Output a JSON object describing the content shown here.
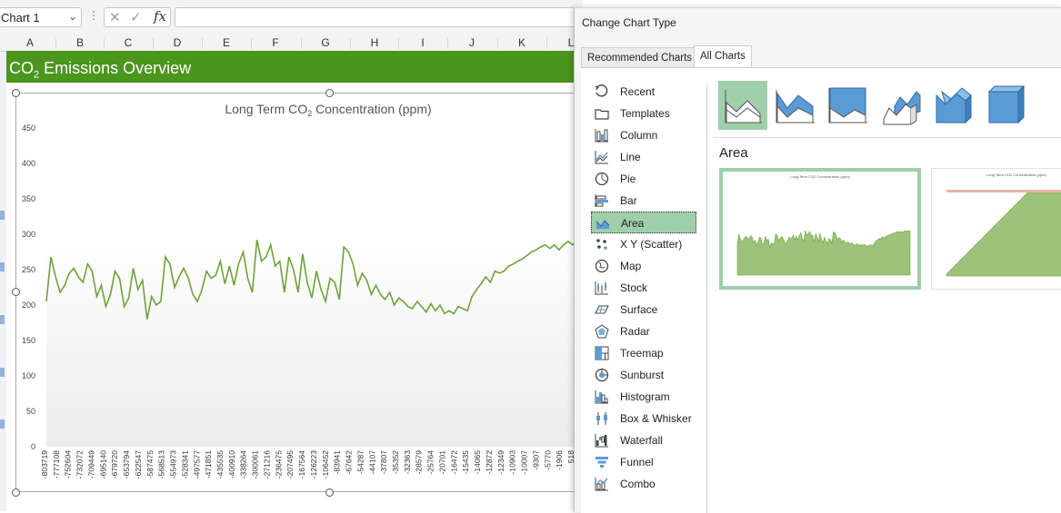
{
  "formula_bar": {
    "name_box": "Chart 1",
    "fx_label": "fx"
  },
  "columns": [
    "A",
    "B",
    "C",
    "D",
    "E",
    "F",
    "G",
    "H",
    "I",
    "J",
    "K",
    "L"
  ],
  "banner": {
    "title_prefix": "CO",
    "title_sub": "2",
    "title_suffix": " Emissions Overview",
    "color": "#4b961d"
  },
  "chart_data": {
    "type": "area",
    "title_prefix": "Long Term CO",
    "title_sub": "2",
    "title_suffix": " Concentration (ppm)",
    "ylim": [
      0,
      450
    ],
    "y_ticks": [
      0,
      50,
      100,
      150,
      200,
      250,
      300,
      350,
      400,
      450
    ],
    "x_tick_labels": [
      "-803719",
      "-777108",
      "-752604",
      "-732072",
      "-709449",
      "-695140",
      "-679720",
      "-653794",
      "-622547",
      "-587475",
      "-568513",
      "-554973",
      "-528341",
      "-497577",
      "-471851",
      "-435535",
      "-400910",
      "-338264",
      "-300061",
      "-271216",
      "-236475",
      "-207495",
      "-167564",
      "-126223",
      "-106452",
      "-83941",
      "-67642",
      "-54287",
      "-44107",
      "-37807",
      "-35352",
      "-32363",
      "-28579",
      "-25764",
      "-20701",
      "-16472",
      "-15435",
      "-14065",
      "-12872",
      "-12349",
      "-10903",
      "-10007",
      "-9307",
      "-5770",
      "-1906",
      "518"
    ],
    "series": [
      {
        "color": "#6ea33a",
        "values": [
          205,
          268,
          240,
          218,
          228,
          245,
          252,
          240,
          232,
          258,
          248,
          212,
          228,
          198,
          215,
          248,
          238,
          198,
          210,
          252,
          222,
          235,
          180,
          212,
          200,
          205,
          268,
          258,
          225,
          240,
          252,
          238,
          215,
          205,
          222,
          248,
          238,
          242,
          262,
          230,
          255,
          228,
          258,
          275,
          238,
          218,
          292,
          262,
          268,
          285,
          255,
          262,
          218,
          268,
          250,
          218,
          272,
          232,
          210,
          248,
          222,
          205,
          238,
          232,
          208,
          282,
          275,
          258,
          228,
          245,
          235,
          215,
          228,
          215,
          208,
          218,
          200,
          210,
          205,
          198,
          195,
          205,
          198,
          190,
          202,
          192,
          200,
          188,
          192,
          188,
          198,
          195,
          192,
          212,
          222,
          230,
          240,
          232,
          248,
          245,
          248,
          255,
          258,
          262,
          265,
          270,
          275,
          278,
          282,
          285,
          280,
          285,
          278,
          285,
          290,
          285,
          292,
          285
        ]
      }
    ]
  },
  "dialog": {
    "title": "Change Chart Type",
    "tabs": [
      "Recommended Charts",
      "All Charts"
    ],
    "chart_types": [
      "Recent",
      "Templates",
      "Column",
      "Line",
      "Pie",
      "Bar",
      "Area",
      "X Y (Scatter)",
      "Map",
      "Stock",
      "Surface",
      "Radar",
      "Treemap",
      "Sunburst",
      "Histogram",
      "Box & Whisker",
      "Waterfall",
      "Funnel",
      "Combo"
    ],
    "selected_type": "Area",
    "subtype_title": "Area",
    "preview_title": "Long Term CO2 Concentration (ppm)",
    "accent": "#9ecfaa",
    "icon_blue": "#5b9bd5"
  }
}
